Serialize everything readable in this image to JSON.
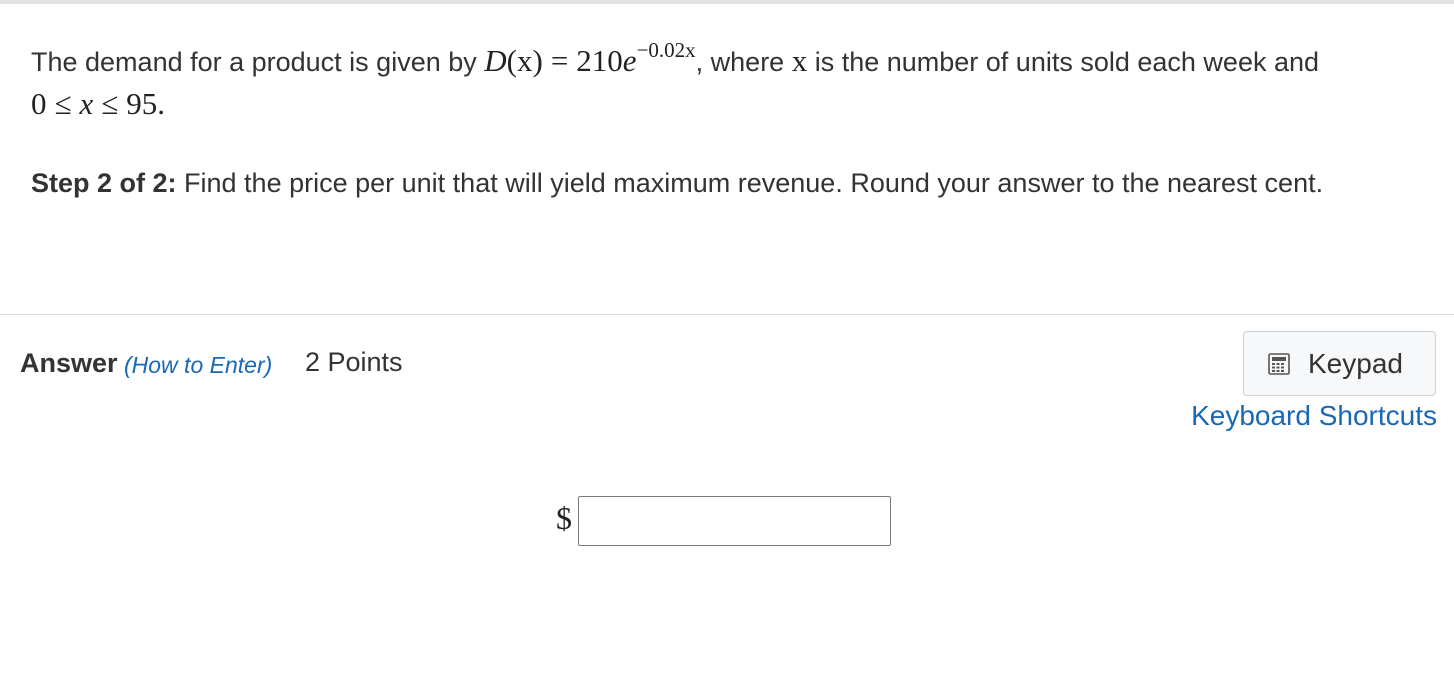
{
  "question": {
    "intro": "The demand for a product is given by ",
    "func_name": "D",
    "func_arg": "(x)",
    "equals": "=",
    "coefficient": "210",
    "base": "e",
    "exponent": "−0.02x",
    "middle": ", where ",
    "var": "x",
    "rest": " is the number of units sold each week and ",
    "range_low": "0",
    "le1": "≤",
    "range_var": "x",
    "le2": "≤",
    "range_high": "95."
  },
  "step": {
    "label": "Step 2 of 2:",
    "text": " Find the price per unit that will yield maximum revenue. Round your answer to the nearest cent."
  },
  "answer": {
    "label": "Answer",
    "how_to": "(How to Enter)",
    "points": "2 Points",
    "currency_symbol": "$",
    "input_value": ""
  },
  "toolbar": {
    "keypad_label": "Keypad",
    "keypad_icon": "calculator-icon",
    "shortcuts_label": "Keyboard Shortcuts"
  },
  "colors": {
    "link": "#1a68b5",
    "text": "#333333",
    "divider": "#d8d8d8"
  }
}
